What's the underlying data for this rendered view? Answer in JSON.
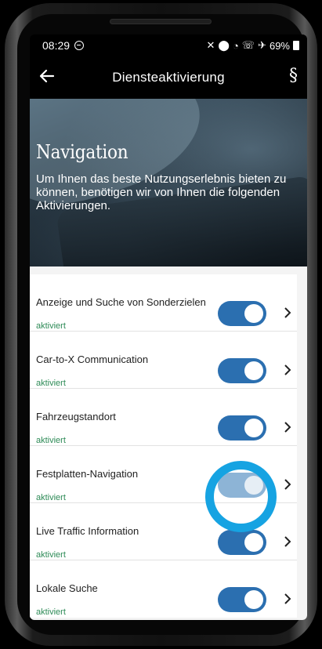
{
  "status_bar": {
    "time": "08:29",
    "battery": "69%",
    "icons": [
      "dnd-icon",
      "mute-icon",
      "location-icon",
      "wifi-icon",
      "wifi-call-icon",
      "wifi-call-icon",
      "airplane-icon",
      "battery-icon"
    ]
  },
  "app_bar": {
    "title": "Diensteaktivierung",
    "back_icon": "arrow-left-icon",
    "legal_icon": "§"
  },
  "hero": {
    "title": "Navigation",
    "description": "Um Ihnen das beste Nutzungserlebnis bieten zu können, benötigen wir von Ihnen die folgenden Aktivierungen."
  },
  "services": [
    {
      "label": "Anzeige und Suche von Sonderzielen",
      "status": "aktiviert",
      "enabled": true
    },
    {
      "label": "Car-to-X Communication",
      "status": "aktiviert",
      "enabled": true
    },
    {
      "label": "Fahrzeugstandort",
      "status": "aktiviert",
      "enabled": true
    },
    {
      "label": "Festplatten-Navigation",
      "status": "aktiviert",
      "enabled": true,
      "disabled_look": true,
      "highlighted": true
    },
    {
      "label": "Live Traffic Information",
      "status": "aktiviert",
      "enabled": true
    },
    {
      "label": "Lokale Suche",
      "status": "aktiviert",
      "enabled": true
    }
  ],
  "colors": {
    "toggle_on": "#2b6fb0",
    "toggle_disabled": "#8db4d6",
    "status_green": "#2e8b57",
    "highlight_ring": "#16a3e2"
  }
}
